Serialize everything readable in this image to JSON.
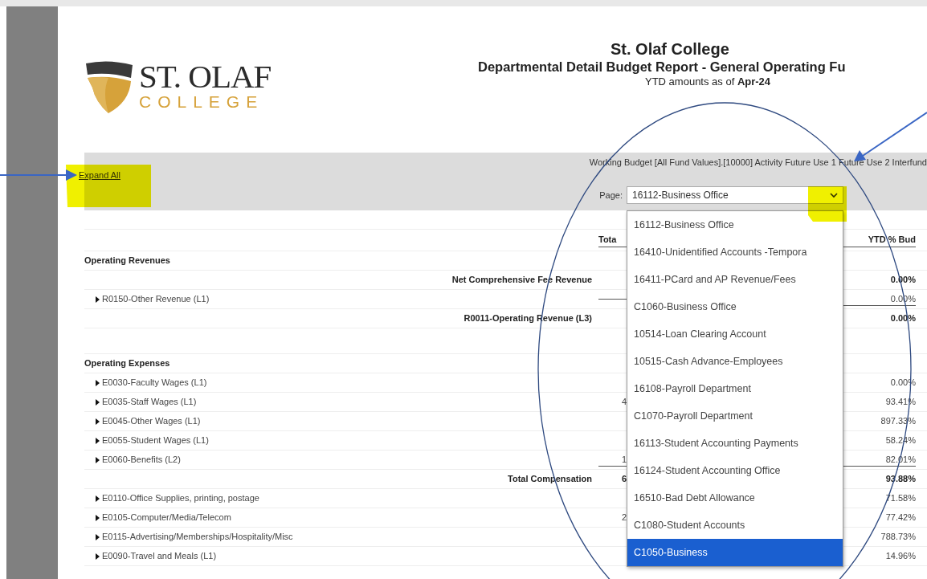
{
  "logo": {
    "name": "ST. OLAF",
    "tagline": "COLLEGE"
  },
  "report": {
    "title": "St. Olaf College",
    "subtitle": "Departmental Detail Budget Report - General Operating Fu",
    "as_of": "YTD amounts as of **Apr-24**"
  },
  "toolbar": {
    "expand_all": "Expand All",
    "filter": "Working Budget [All Fund Values].[10000] Activity Future Use 1 Future Use 2 Interfund",
    "page_label": "Page:",
    "page_value": "16112-Business Office"
  },
  "page_dropdown": {
    "expanded": true,
    "options": [
      {
        "label": "16112-Business Office",
        "selected": false
      },
      {
        "label": "16410-Unidentified Accounts -Tempora",
        "selected": false
      },
      {
        "label": "16411-PCard and AP Revenue/Fees",
        "selected": false
      },
      {
        "label": "C1060-Business Office",
        "selected": false
      },
      {
        "label": "10514-Loan Clearing Account",
        "selected": false
      },
      {
        "label": "10515-Cash Advance-Employees",
        "selected": false
      },
      {
        "label": "16108-Payroll Department",
        "selected": false
      },
      {
        "label": "C1070-Payroll Department",
        "selected": false
      },
      {
        "label": "16113-Student Accounting Payments",
        "selected": false
      },
      {
        "label": "16124-Student Accounting Office",
        "selected": false
      },
      {
        "label": "16510-Bad Debt Allowance",
        "selected": false
      },
      {
        "label": "C1080-Student Accounts",
        "selected": false
      },
      {
        "label": "C1050-Business",
        "selected": true
      }
    ]
  },
  "table": {
    "columns": [
      "Tota",
      "YTD % Bud"
    ],
    "rows": [
      {
        "kind": "section",
        "label": "Operating Revenues"
      },
      {
        "kind": "total",
        "label": "Net Comprehensive Fee Revenue",
        "ytd_pct_bud": "0.00%"
      },
      {
        "kind": "line",
        "label": "R0150-Other Revenue (L1)",
        "ytd_pct_bud": "0.00%"
      },
      {
        "kind": "total",
        "label": "R0011-Operating Revenue (L3)",
        "ytd_pct_bud": "0.00%"
      },
      {
        "kind": "blank"
      },
      {
        "kind": "section",
        "label": "Operating Expenses"
      },
      {
        "kind": "line",
        "label": "E0030-Faculty Wages (L1)",
        "ytd_pct_bud": "0.00%"
      },
      {
        "kind": "line",
        "label": "E0035-Staff Wages (L1)",
        "total": "4",
        "ytd_pct_bud": "93.41%"
      },
      {
        "kind": "line",
        "label": "E0045-Other Wages (L1)",
        "ytd_pct_bud": "897.33%"
      },
      {
        "kind": "line",
        "label": "E0055-Student Wages (L1)",
        "ytd_pct_bud": "58.24%"
      },
      {
        "kind": "line",
        "label": "E0060-Benefits (L2)",
        "total": "1",
        "ytd_pct_bud": "82.01%"
      },
      {
        "kind": "total",
        "label": "Total Compensation",
        "total": "6",
        "ytd_pct_bud": "93.88%"
      },
      {
        "kind": "line",
        "label": "E0110-Office Supplies, printing, postage",
        "ytd_pct_bud": "71.58%"
      },
      {
        "kind": "line",
        "label": "E0105-Computer/Media/Telecom",
        "total": "2",
        "ytd_pct_bud": "77.42%"
      },
      {
        "kind": "line",
        "label": "E0115-Advertising/Memberships/Hospitality/Misc",
        "ytd_pct_bud": "788.73%"
      },
      {
        "kind": "line",
        "label": "E0090-Travel and Meals (L1)",
        "ytd_pct_bud": "14.96%"
      }
    ]
  }
}
